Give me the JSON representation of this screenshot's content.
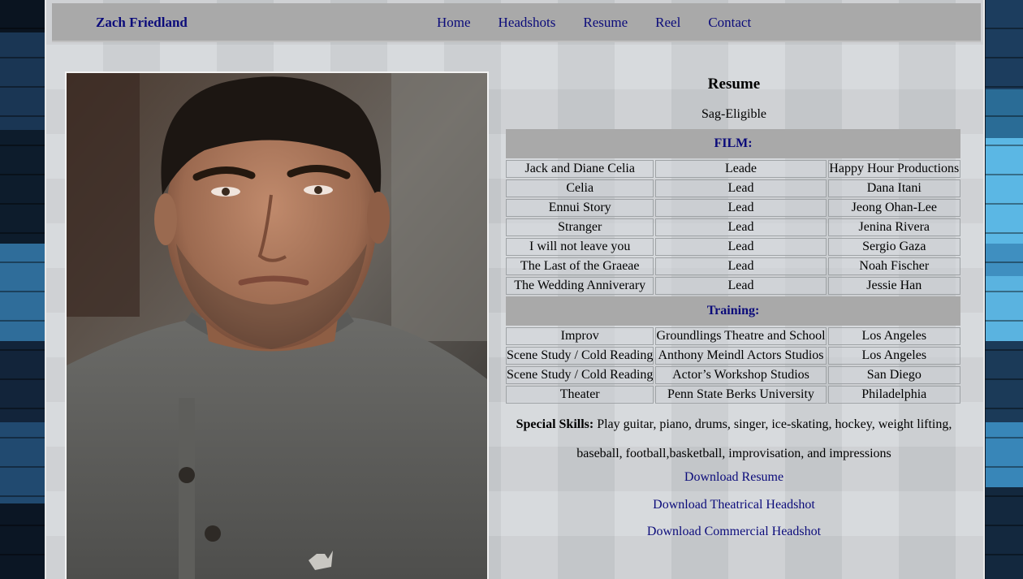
{
  "navbar": {
    "brand": "Zach Friedland",
    "links": [
      "Home",
      "Headshots",
      "Resume",
      "Reel",
      "Contact"
    ]
  },
  "resume": {
    "title": "Resume",
    "subtitle": "Sag-Eligible",
    "film_heading": "FILM:",
    "film": [
      [
        "Jack and Diane Celia",
        "Leade",
        "Happy Hour Productions"
      ],
      [
        "Celia",
        "Lead",
        "Dana Itani"
      ],
      [
        "Ennui Story",
        "Lead",
        "Jeong Ohan-Lee"
      ],
      [
        "Stranger",
        "Lead",
        "Jenina Rivera"
      ],
      [
        "I will not leave you",
        "Lead",
        "Sergio Gaza"
      ],
      [
        "The Last of the Graeae",
        "Lead",
        "Noah Fischer"
      ],
      [
        "The Wedding Anniverary",
        "Lead",
        "Jessie Han"
      ]
    ],
    "training_heading": "Training:",
    "training": [
      [
        "Improv",
        "Groundlings Theatre and School",
        "Los Angeles"
      ],
      [
        "Scene Study / Cold Reading",
        "Anthony Meindl Actors Studios",
        "Los Angeles"
      ],
      [
        "Scene Study / Cold Reading",
        "Actor’s Workshop Studios",
        "San Diego"
      ],
      [
        "Theater",
        "Penn State Berks University",
        "Philadelphia"
      ]
    ],
    "skills_label": "Special Skills:",
    "skills_text": "Play guitar, piano, drums, singer, ice-skating, hockey, weight lifting, baseball, football,basketball, improvisation, and impressions",
    "downloads": [
      "Download Resume",
      "Download Theatrical Headshot",
      "Download Commercial Headshot"
    ]
  }
}
